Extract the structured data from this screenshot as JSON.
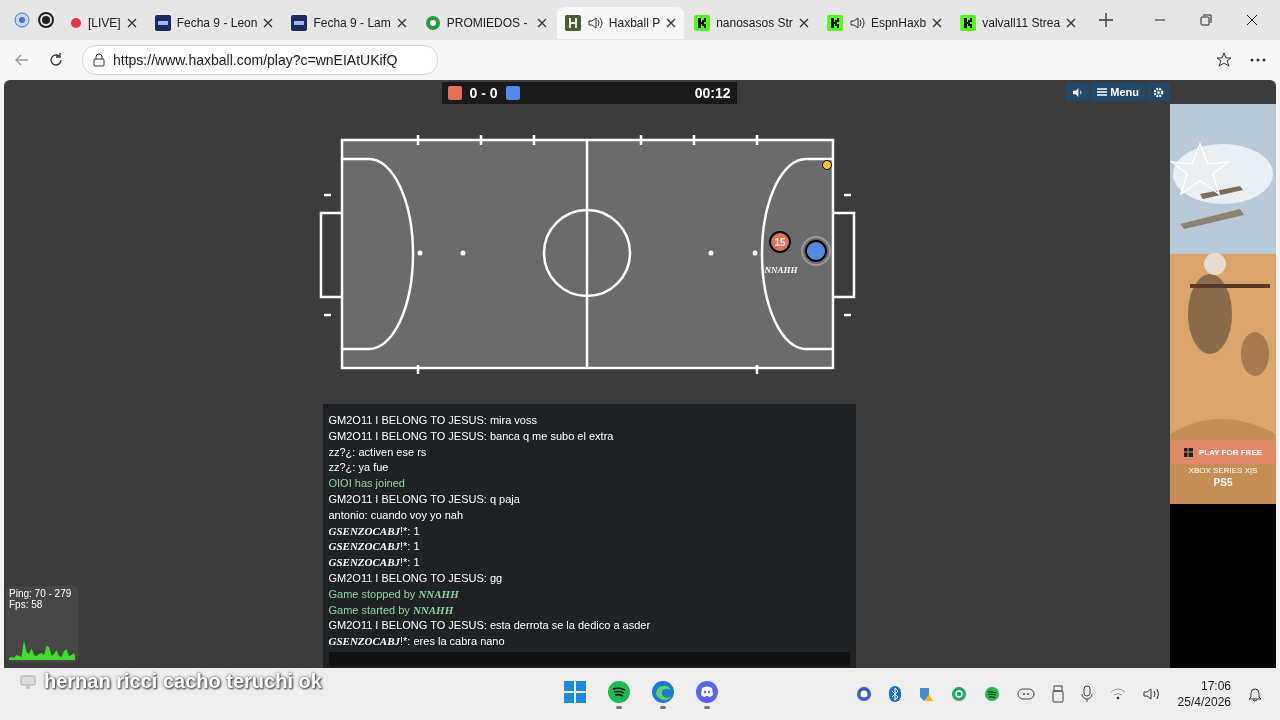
{
  "browser": {
    "tabs": [
      {
        "title": "[LIVE]",
        "kind": "live",
        "audio": false,
        "selected": false
      },
      {
        "title": "Fecha 9 - Leon",
        "kind": "lpf",
        "audio": false,
        "selected": false
      },
      {
        "title": "Fecha 9 - Lam",
        "kind": "lpf",
        "audio": false,
        "selected": false
      },
      {
        "title": "PROMIEDOS - ",
        "kind": "ball",
        "audio": false,
        "selected": false
      },
      {
        "title": "Haxball P",
        "kind": "hax",
        "audio": true,
        "selected": true
      },
      {
        "title": "nanosasos Str",
        "kind": "kick",
        "audio": false,
        "selected": false
      },
      {
        "title": "EspnHaxb",
        "kind": "kick",
        "audio": true,
        "selected": false
      },
      {
        "title": "valvall11 Strea",
        "kind": "kick",
        "audio": false,
        "selected": false
      }
    ],
    "url": "https://www.haxball.com/play?c=wnEIAtUKifQ"
  },
  "game": {
    "score_red": "0",
    "score_sep": "-",
    "score_blue": "0",
    "time": "00:12",
    "menu_label": "Menu",
    "players": [
      {
        "color": "#e56e56",
        "number": "15",
        "name": "NNAHH"
      },
      {
        "color": "#5689e5"
      }
    ],
    "chat": [
      {
        "kind": "message",
        "fancy": false,
        "author": "GM2O11 I BELONG TO JESUS:",
        "text": "mira voss"
      },
      {
        "kind": "message",
        "fancy": false,
        "author": "GM2O11 I BELONG TO JESUS:",
        "text": "banca q me subo el extra"
      },
      {
        "kind": "message",
        "fancy": false,
        "author": "zz?¿:",
        "text": "activen ese rs"
      },
      {
        "kind": "message",
        "fancy": false,
        "author": "zz?¿:",
        "text": "ya fue"
      },
      {
        "kind": "system",
        "text": "OIOI has joined"
      },
      {
        "kind": "message",
        "fancy": false,
        "author": "GM2O11 I BELONG TO JESUS:",
        "text": "q paja"
      },
      {
        "kind": "message",
        "fancy": false,
        "author": "antonio:",
        "text": "cuando voy yo nah"
      },
      {
        "kind": "message",
        "fancy": true,
        "author": "GSENZOCABJ",
        "author_suffix": "!*:",
        "text": "1"
      },
      {
        "kind": "message",
        "fancy": true,
        "author": "GSENZOCABJ",
        "author_suffix": "!*:",
        "text": "1"
      },
      {
        "kind": "message",
        "fancy": true,
        "author": "GSENZOCABJ",
        "author_suffix": "!*:",
        "text": "1"
      },
      {
        "kind": "message",
        "fancy": false,
        "author": "GM2O11 I BELONG TO JESUS:",
        "text": "gg"
      },
      {
        "kind": "system",
        "text": "Game stopped by **NNAHH**"
      },
      {
        "kind": "system",
        "text": "Game started by **NNAHH**"
      },
      {
        "kind": "message",
        "fancy": false,
        "author": "GM2O11 I BELONG TO JESUS:",
        "text": "esta derrota se la dedico a asder"
      },
      {
        "kind": "message",
        "fancy": true,
        "author": "GSENZOCABJ",
        "author_suffix": "!*:",
        "text": "eres la cabra nano"
      }
    ],
    "stats": {
      "ping": "Ping: 70 - 279",
      "fps": "Fps: 58"
    }
  },
  "ad": {
    "cta": "PLAY FOR FREE",
    "platform_1": "XBOX SERIES X|S",
    "platform_2": "PS5"
  },
  "overlay_caption": "hernan ricci cacho teruchi ok",
  "taskbar": {
    "apps": [
      {
        "kind": "start",
        "running": false
      },
      {
        "kind": "spotify",
        "running": true
      },
      {
        "kind": "edge",
        "running": true
      },
      {
        "kind": "discord",
        "running": true
      }
    ],
    "time": "17:06",
    "date": "25/4/2026"
  }
}
